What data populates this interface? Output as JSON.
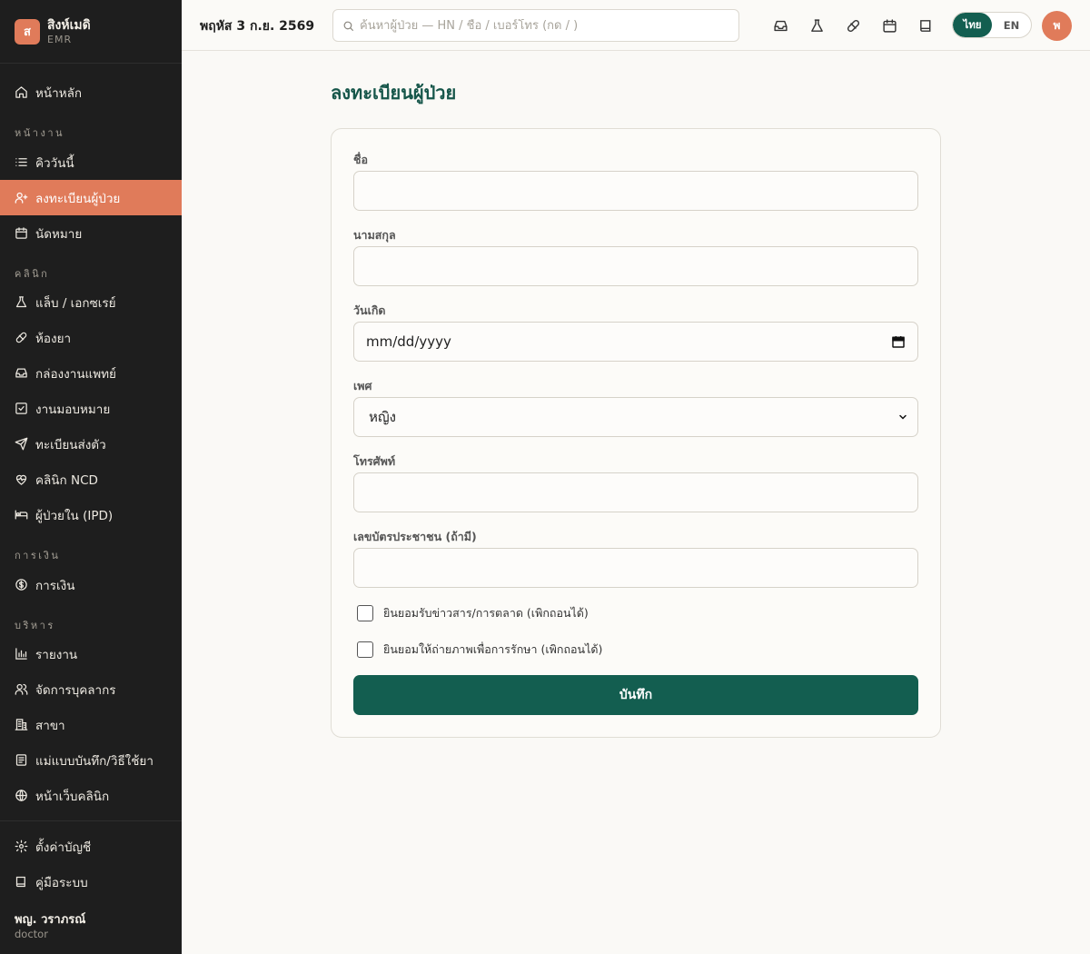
{
  "brand": {
    "logo_letter": "ส",
    "name": "สิงห์เมดิ",
    "sub": "EMR"
  },
  "sidebar": {
    "home": "หน้าหลัก",
    "sections": {
      "work": "หน้างาน",
      "clinic": "คลินิก",
      "finance": "การเงิน",
      "admin": "บริหาร"
    },
    "items": {
      "queue": "คิววันนี้",
      "register": "ลงทะเบียนผู้ป่วย",
      "appointments": "นัดหมาย",
      "lab": "แล็บ / เอกซเรย์",
      "pharmacy": "ห้องยา",
      "inbox": "กล่องงานแพทย์",
      "tasks": "งานมอบหมาย",
      "referral": "ทะเบียนส่งตัว",
      "ncd": "คลินิก NCD",
      "ipd": "ผู้ป่วยใน (IPD)",
      "billing": "การเงิน",
      "reports": "รายงาน",
      "staff": "จัดการบุคลากร",
      "branch": "สาขา",
      "templates": "แม่แบบบันทึก/วิธีใช้ยา",
      "website": "หน้าเว็บคลินิก",
      "settings": "ตั้งค่าบัญชี",
      "manual": "คู่มือระบบ"
    },
    "user": {
      "name": "พญ. วราภรณ์",
      "role": "doctor"
    }
  },
  "topbar": {
    "date": "พฤหัส 3 ก.ย. 2569",
    "search_placeholder": "ค้นหาผู้ป่วย — HN / ชื่อ / เบอร์โทร (กด / )",
    "lang": {
      "thai": "ไทย",
      "en": "EN",
      "active": "thai"
    },
    "avatar_letter": "พ"
  },
  "page": {
    "title": "ลงทะเบียนผู้ป่วย",
    "fields": {
      "first_name": {
        "label": "ชื่อ",
        "value": ""
      },
      "last_name": {
        "label": "นามสกุล",
        "value": ""
      },
      "dob": {
        "label": "วันเกิด",
        "placeholder": "mm/dd/yyyy"
      },
      "sex": {
        "label": "เพศ",
        "value": "หญิง"
      },
      "phone": {
        "label": "โทรศัพท์",
        "value": ""
      },
      "national_id": {
        "label": "เลขบัตรประชาชน (ถ้ามี)",
        "value": ""
      }
    },
    "consents": {
      "marketing": {
        "label": "ยินยอมรับข่าวสาร/การตลาด (เพิกถอนได้)",
        "checked": false
      },
      "photo": {
        "label": "ยินยอมให้ถ่ายภาพเพื่อการรักษา (เพิกถอนได้)",
        "checked": false
      }
    },
    "save_label": "บันทึก"
  },
  "colors": {
    "accent": "#e07b5a",
    "primary": "#135e50",
    "sidebar_bg": "#1e1e1e"
  }
}
